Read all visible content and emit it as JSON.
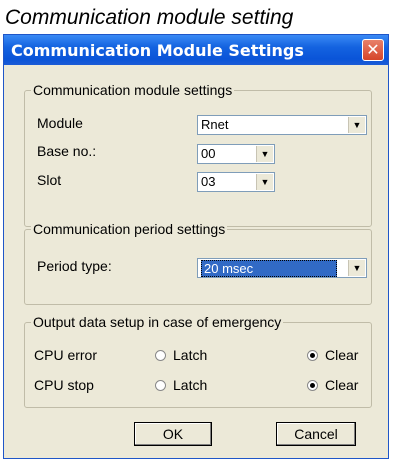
{
  "caption": "Communication module setting",
  "window": {
    "title": "Communication Module Settings",
    "close_glyph": "✕"
  },
  "module_settings": {
    "legend": "Communication module settings",
    "module_label": "Module",
    "module_value": "Rnet",
    "base_label": "Base no.:",
    "base_value": "00",
    "slot_label": "Slot",
    "slot_value": "03"
  },
  "period_settings": {
    "legend": "Communication period settings",
    "period_label": "Period type:",
    "period_value": "20 msec"
  },
  "emergency": {
    "legend": "Output data setup in case of emergency",
    "cpu_error_label": "CPU error",
    "cpu_stop_label": "CPU stop",
    "latch": "Latch",
    "clear": "Clear"
  },
  "buttons": {
    "ok": "OK",
    "cancel": "Cancel"
  },
  "icons": {
    "dropdown": "▼"
  }
}
